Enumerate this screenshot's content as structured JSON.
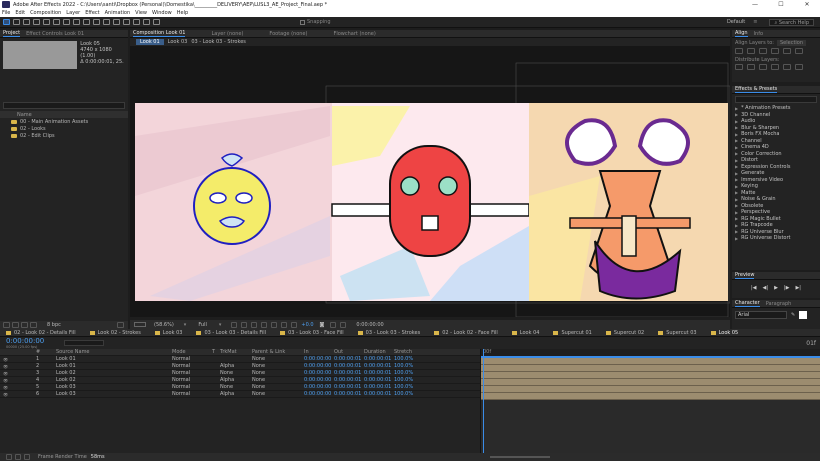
{
  "title": "Adobe After Effects 2022 - C:\\Users\\santi\\Dropbox (Personal)\\Domestika\\_________DELIVERY\\AEP\\LUSL3_AE_Project_Final.aep *",
  "window_controls": [
    "—",
    "☐",
    "✕"
  ],
  "menu": [
    "File",
    "Edit",
    "Composition",
    "Layer",
    "Effect",
    "Animation",
    "View",
    "Window",
    "Help"
  ],
  "toolbar": {
    "snapping": "Snapping",
    "workspace": "Default",
    "search": "Search Help"
  },
  "project": {
    "tab": "Project",
    "effect_controls": "Effect Controls Look 01",
    "selected_name": "Look 05",
    "selected_info": "4740 x 1080 (1.00)",
    "selected_dur": "Δ 0:00:00:01, 25.",
    "col_name": "Name",
    "items": [
      "00 - Main Animation Assets",
      "02 - Looks",
      "02 - Edit Clips"
    ],
    "bpc": "8 bpc"
  },
  "comp": {
    "tab": "Composition Look 01",
    "layer_tab": "Layer (none)",
    "footage_tab": "Footage (none)",
    "flowchart_tab": "Flowchart (none)",
    "breadcrumbs": [
      "Look 01",
      "Look 03",
      "03 - Look 03 - Strokes"
    ],
    "zoom": "(58.6%)",
    "res": "Full",
    "exposure": "+0.0",
    "time": "0:00:00:00"
  },
  "align": {
    "tab": "Align",
    "info_tab": "Info",
    "align_layers": "Align Layers to:",
    "align_target": "Selection",
    "distribute": "Distribute Layers:"
  },
  "effects": {
    "tab": "Effects & Presets",
    "items": [
      "* Animation Presets",
      "3D Channel",
      "Audio",
      "Blur & Sharpen",
      "Boris FX Mocha",
      "Channel",
      "Cinema 4D",
      "Color Correction",
      "Distort",
      "Expression Controls",
      "Generate",
      "Immersive Video",
      "Keying",
      "Matte",
      "Noise & Grain",
      "Obsolete",
      "Perspective",
      "RG Magic Bullet",
      "RG Trapcode",
      "RG Universe Blur",
      "RG Universe Distort"
    ]
  },
  "preview": {
    "tab": "Preview"
  },
  "character": {
    "tab": "Character",
    "para_tab": "Paragraph",
    "font": "Arial"
  },
  "timeline": {
    "tabs": [
      "02 - Look 02 - Details Fill",
      "Look 02 - Strokes",
      "Look 03",
      "03 - Look 03 - Details Fill",
      "03 - Look 03 - Face Fill",
      "03 - Look 03 - Strokes",
      "02 - Look 02 - Face Fill",
      "Look 04",
      "Supercut 01",
      "Supercut 02",
      "Supercut 03",
      "Look 05"
    ],
    "time": "0:00:00:00",
    "time_sub": "00000 (25.00 fps)",
    "headers": [
      "#",
      "Source Name",
      "Mode",
      "T",
      "TrkMat",
      "Parent & Link",
      "In",
      "Out",
      "Duration",
      "Stretch"
    ],
    "layers": [
      {
        "num": "1",
        "name": "Look 01",
        "mode": "Normal",
        "trk": "",
        "parent": "None",
        "in": "0:00:00:00",
        "out": "0:00:00:01",
        "dur": "0:00:00:01",
        "stretch": "100.0%"
      },
      {
        "num": "2",
        "name": "Look 01",
        "mode": "Normal",
        "trk": "Alpha",
        "parent": "None",
        "in": "0:00:00:00",
        "out": "0:00:00:01",
        "dur": "0:00:00:01",
        "stretch": "100.0%"
      },
      {
        "num": "3",
        "name": "Look 02",
        "mode": "Normal",
        "trk": "None",
        "parent": "None",
        "in": "0:00:00:00",
        "out": "0:00:00:01",
        "dur": "0:00:00:01",
        "stretch": "100.0%"
      },
      {
        "num": "4",
        "name": "Look 02",
        "mode": "Normal",
        "trk": "Alpha",
        "parent": "None",
        "in": "0:00:00:00",
        "out": "0:00:00:01",
        "dur": "0:00:00:01",
        "stretch": "100.0%"
      },
      {
        "num": "5",
        "name": "Look 03",
        "mode": "Normal",
        "trk": "None",
        "parent": "None",
        "in": "0:00:00:00",
        "out": "0:00:00:01",
        "dur": "0:00:00:01",
        "stretch": "100.0%"
      },
      {
        "num": "6",
        "name": "Look 03",
        "mode": "Normal",
        "trk": "Alpha",
        "parent": "None",
        "in": "0:00:00:00",
        "out": "0:00:00:01",
        "dur": "0:00:00:01",
        "stretch": "100.0%"
      }
    ],
    "ruler_start": "00f",
    "ruler_end": "01f",
    "render_label": "Frame Render Time",
    "render_value": "58ms"
  }
}
